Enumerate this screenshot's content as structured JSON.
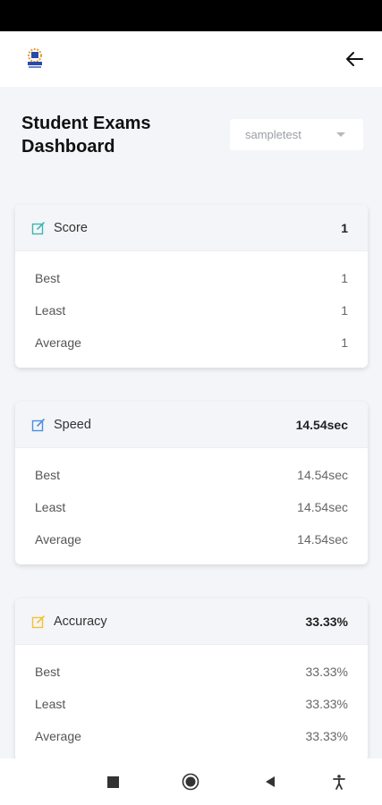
{
  "page": {
    "title": "Student Exams Dashboard"
  },
  "exam_select": {
    "value": "sampletest"
  },
  "cards": [
    {
      "title": "Score",
      "total": "1",
      "icon": "edit-icon",
      "icon_color": "#3fb6b0",
      "rows": [
        {
          "label": "Best",
          "value": "1"
        },
        {
          "label": "Least",
          "value": "1"
        },
        {
          "label": "Average",
          "value": "1"
        }
      ]
    },
    {
      "title": "Speed",
      "total": "14.54sec",
      "icon": "edit-icon",
      "icon_color": "#4a8fe0",
      "rows": [
        {
          "label": "Best",
          "value": "14.54sec"
        },
        {
          "label": "Least",
          "value": "14.54sec"
        },
        {
          "label": "Average",
          "value": "14.54sec"
        }
      ]
    },
    {
      "title": "Accuracy",
      "total": "33.33%",
      "icon": "edit-icon",
      "icon_color": "#f2c230",
      "rows": [
        {
          "label": "Best",
          "value": "33.33%"
        },
        {
          "label": "Least",
          "value": "33.33%"
        },
        {
          "label": "Average",
          "value": "33.33%"
        }
      ]
    }
  ],
  "navigation": {
    "buttons": [
      "square-icon",
      "circle-icon",
      "back-triangle-icon",
      "accessibility-icon"
    ]
  },
  "colors": {
    "background": "#f3f5f8",
    "card_header": "#f4f5f8"
  }
}
